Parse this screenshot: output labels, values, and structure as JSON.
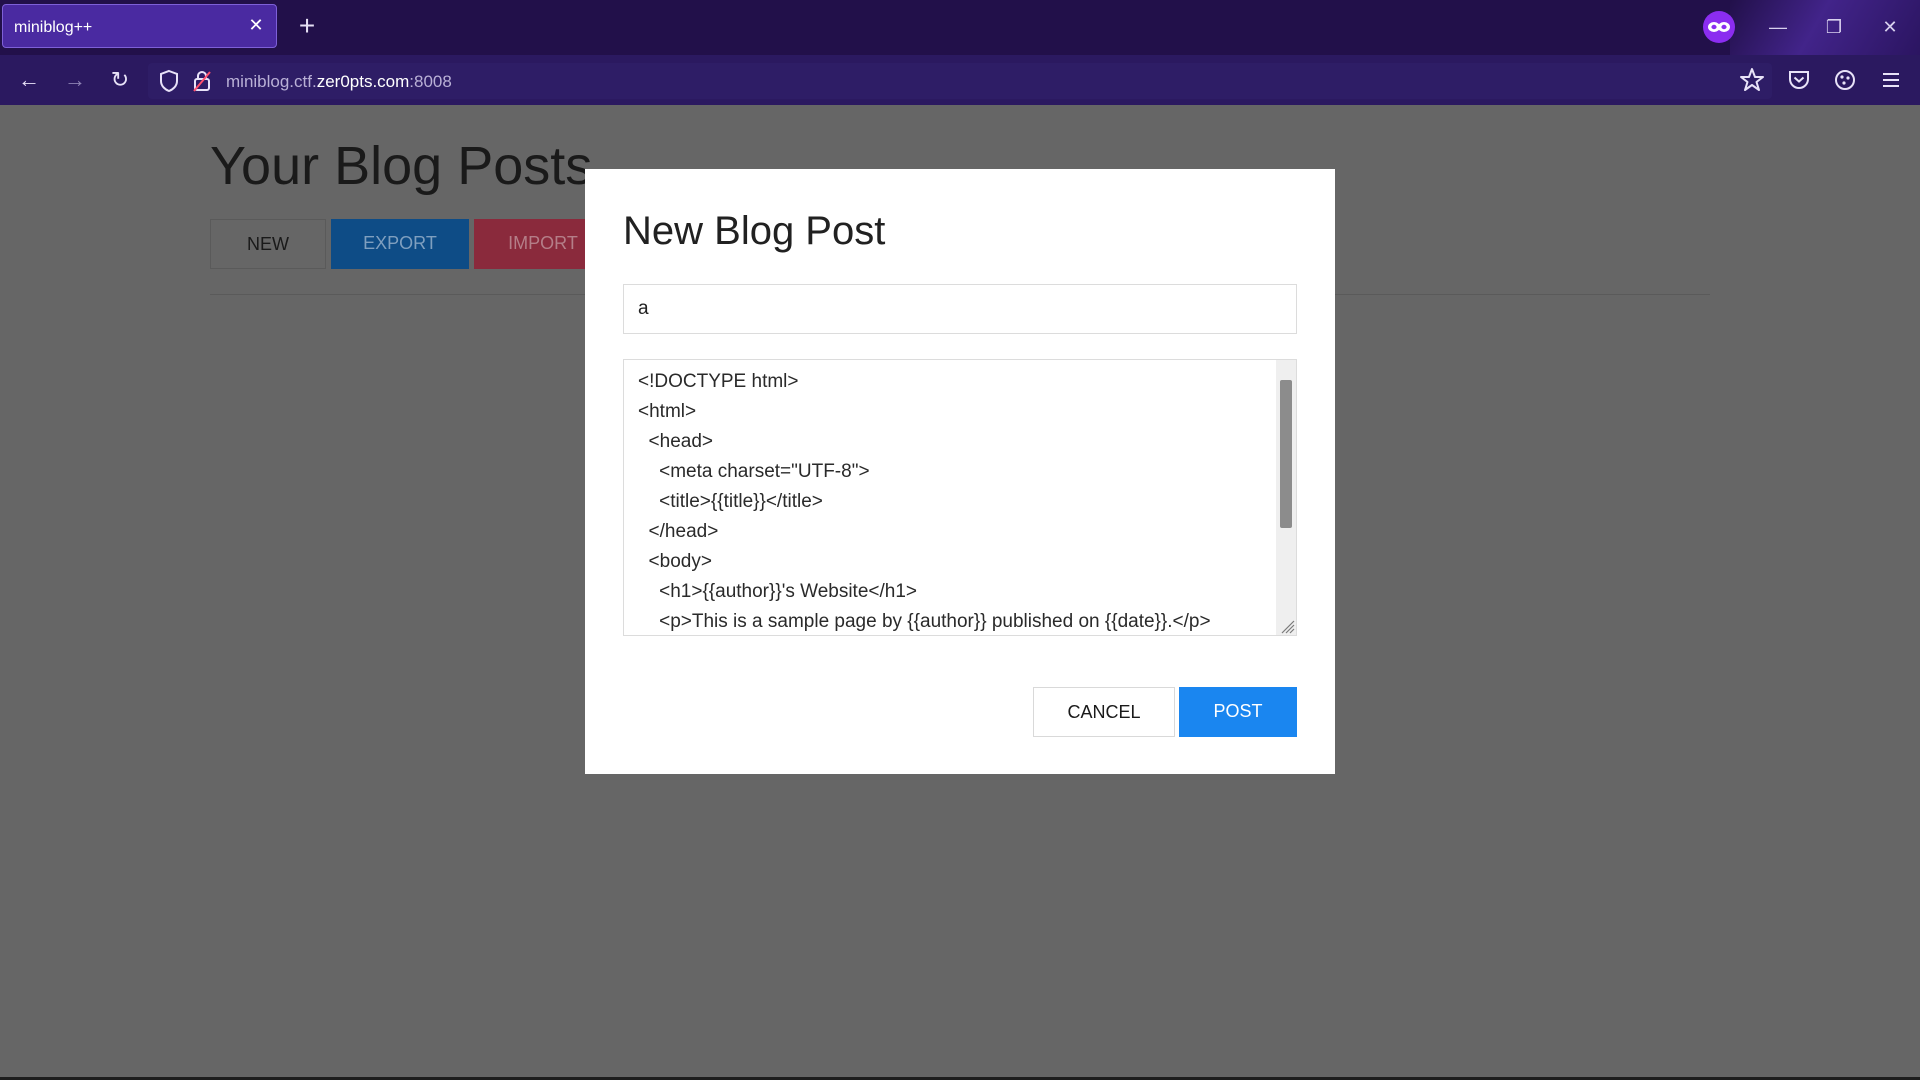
{
  "browser": {
    "tab": {
      "title": "miniblog++",
      "close_glyph": "✕"
    },
    "new_tab_glyph": "+",
    "url": {
      "prefix": "miniblog.ctf.",
      "domain": "zer0pts.com",
      "port": ":8008"
    },
    "window_controls": {
      "minimize": "—",
      "restore": "❐",
      "close": "✕"
    },
    "nav": {
      "back": "←",
      "forward": "→",
      "reload": "↻"
    },
    "icons": [
      "private-browsing-icon",
      "shield-icon",
      "lock-icon",
      "bookmark-star-icon",
      "pocket-icon",
      "extensions-icon",
      "menu-icon"
    ],
    "colors": {
      "titlebar": "#22104a",
      "toolbar": "#2b1960",
      "tab": "#4a2aa1"
    }
  },
  "page": {
    "title": "Your Blog Posts",
    "buttons": {
      "new": "NEW",
      "export": "EXPORT",
      "import": "IMPORT"
    }
  },
  "modal": {
    "title": "New Blog Post",
    "title_value": "a",
    "content_lines": [
      "<!DOCTYPE html>",
      "<html>",
      "  <head>",
      "    <meta charset=\"UTF-8\">",
      "    <title>{{title}}</title>",
      "  </head>",
      "  <body>",
      "    <h1>{{author}}'s Website</h1>",
      "    <p>This is a sample page by {{author}} published on {{date}}.</p>"
    ],
    "cancel_label": "CANCEL",
    "post_label": "POST",
    "colors": {
      "post": "#1a86f0",
      "export": "#0e4c86",
      "import": "#8a2a3c",
      "overlay": "#666666"
    }
  }
}
